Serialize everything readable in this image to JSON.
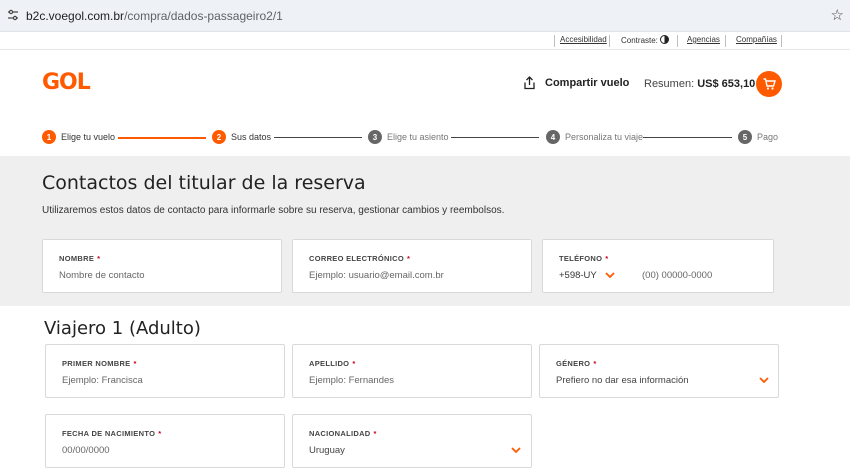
{
  "browser": {
    "url_host": "b2c.voegol.com.br",
    "url_path": "/compra/dados-passageiro2/1"
  },
  "utility": {
    "accessibility": "Accesibilidad",
    "contrast": "Contraste:",
    "agencies": "Agencias",
    "companies": "Compañías"
  },
  "header": {
    "logo": "GOL",
    "share": "Compartir vuelo",
    "summary_label": "Resumen:",
    "summary_amount": "US$ 653,10"
  },
  "steps": [
    {
      "num": "1",
      "label": "Elige tu vuelo"
    },
    {
      "num": "2",
      "label": "Sus datos"
    },
    {
      "num": "3",
      "label": "Elige tu asiento"
    },
    {
      "num": "4",
      "label": "Personaliza tu viaje"
    },
    {
      "num": "5",
      "label": "Pago"
    }
  ],
  "contact": {
    "title": "Contactos del titular de la reserva",
    "description": "Utilizaremos estos datos de contacto para informarle sobre su reserva, gestionar cambios y reembolsos.",
    "name_label": "NOMBRE",
    "name_placeholder": "Nombre de contacto",
    "email_label": "CORREO ELECTRÓNICO",
    "email_placeholder": "Ejemplo: usuario@email.com.br",
    "phone_label": "TELÉFONO",
    "phone_code": "+598-UY",
    "phone_placeholder": "(00) 00000-0000"
  },
  "traveler": {
    "title": "Viajero 1 (Adulto)",
    "first_name_label": "PRIMER NOMBRE",
    "first_name_placeholder": "Ejemplo: Francisca",
    "last_name_label": "APELLIDO",
    "last_name_placeholder": "Ejemplo: Fernandes",
    "gender_label": "GÉNERO",
    "gender_value": "Prefiero no dar esa información",
    "birth_label": "FECHA DE NACIMIENTO",
    "birth_placeholder": "00/00/0000",
    "nationality_label": "NACIONALIDAD",
    "nationality_value": "Uruguay"
  },
  "required_mark": "*",
  "colors": {
    "accent": "#ff5a00",
    "required": "#d0021b"
  }
}
